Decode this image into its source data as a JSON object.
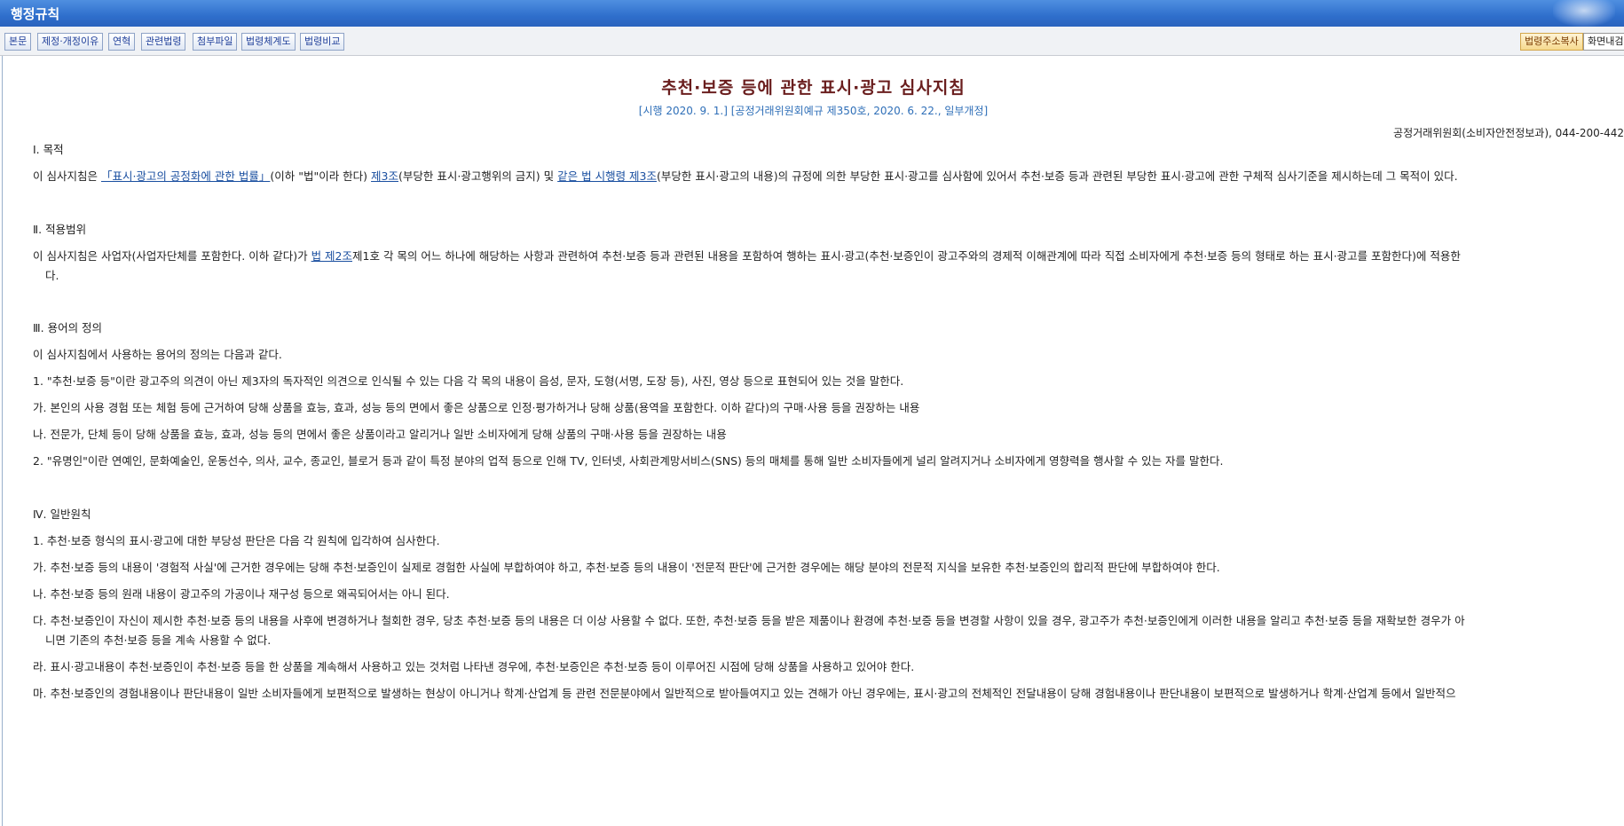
{
  "window": {
    "title": "행정규칙"
  },
  "toolbar": {
    "buttons": [
      "본문",
      "제정·개정이유",
      "연혁",
      "관련법령",
      "첨부파일",
      "법령체계도",
      "법령비교"
    ],
    "copy_address": "법령주소복사",
    "screen_content": "화면내검"
  },
  "doc": {
    "title": "추천·보증 등에 관한 표시·광고 심사지침",
    "subtitle": "[시행 2020. 9. 1.] [공정거래위원회예규 제350호, 2020. 6. 22., 일부개정]",
    "department": "공정거래위원회(소비자안전정보과), 044-200-442",
    "s1": {
      "heading": "Ⅰ. 목적",
      "p_a": "이 심사지침은 ",
      "link_law": "「표시·광고의 공정화에 관한 법률」",
      "p_b": "(이하 \"법\"이라 한다) ",
      "link_art3": "제3조",
      "p_c": "(부당한 표시·광고행위의 금지) 및 ",
      "link_decree": "같은 법 시행령 제3조",
      "p_d": "(부당한 표시·광고의 내용)의 규정에 의한 부당한 표시·광고를 심사함에 있어서 추천·보증 등과 관련된 부당한 표시·광고에 관한 구체적 심사기준을 제시하는데 그 목적이 있다."
    },
    "s2": {
      "heading": "Ⅱ. 적용범위",
      "p_a": "이 심사지침은 사업자(사업자단체를 포함한다. 이하 같다)가 ",
      "link_art2": "법 제2조",
      "p_b": "제1호 각 목의 어느 하나에 해당하는 사항과 관련하여 추천·보증 등과 관련된 내용을 포함하여 행하는 표시·광고(추천·보증인이 광고주와의 경제적 이해관계에 따라 직접 소비자에게 추천·보증 등의 형태로 하는 표시·광고를 포함한다)에 적용한",
      "p_c": "다."
    },
    "s3": {
      "heading": "Ⅲ. 용어의 정의",
      "intro": "이 심사지침에서 사용하는 용어의 정의는 다음과 같다.",
      "item1": "1. \"추천·보증 등\"이란 광고주의 의견이 아닌 제3자의 독자적인 의견으로 인식될 수 있는 다음 각 목의 내용이 음성, 문자, 도형(서명, 도장 등), 사진, 영상 등으로 표현되어 있는 것을 말한다.",
      "item1_ga": "가. 본인의 사용 경험 또는 체험 등에 근거하여 당해 상품을 효능, 효과, 성능 등의 면에서 좋은 상품으로 인정·평가하거나 당해 상품(용역을 포함한다. 이하 같다)의 구매·사용 등을 권장하는 내용",
      "item1_na": "나. 전문가, 단체 등이 당해 상품을 효능, 효과, 성능 등의 면에서 좋은 상품이라고 알리거나 일반 소비자에게 당해 상품의 구매·사용 등을 권장하는 내용",
      "item2": "2. \"유명인\"이란 연예인, 문화예술인, 운동선수, 의사, 교수, 종교인, 블로거 등과 같이 특정 분야의 업적 등으로 인해 TV, 인터넷, 사회관계망서비스(SNS) 등의 매체를 통해 일반 소비자들에게 널리 알려지거나 소비자에게 영향력을 행사할 수 있는 자를 말한다."
    },
    "s4": {
      "heading": "Ⅳ. 일반원칙",
      "item1": "1. 추천·보증 형식의 표시·광고에 대한 부당성 판단은 다음 각 원칙에 입각하여 심사한다.",
      "ga": "가. 추천·보증 등의 내용이 '경험적 사실'에 근거한 경우에는 당해 추천·보증인이 실제로 경험한 사실에 부합하여야 하고, 추천·보증 등의 내용이 '전문적 판단'에 근거한 경우에는 해당 분야의 전문적 지식을 보유한 추천·보증인의 합리적 판단에 부합하여야 한다.",
      "na": "나. 추천·보증 등의 원래 내용이 광고주의 가공이나 재구성 등으로 왜곡되어서는 아니 된다.",
      "da": "다. 추천·보증인이 자신이 제시한 추천·보증 등의 내용을 사후에 변경하거나 철회한 경우, 당초 추천·보증 등의 내용은 더 이상 사용할 수 없다. 또한, 추천·보증 등을 받은 제품이나 환경에 추천·보증 등을 변경할 사항이 있을 경우, 광고주가 추천·보증인에게 이러한 내용을 알리고 추천·보증 등을 재확보한 경우가 아",
      "da_cont": "니면 기존의 추천·보증 등을 계속 사용할 수 없다.",
      "ra": "라. 표시·광고내용이 추천·보증인이 추천·보증 등을 한 상품을 계속해서 사용하고 있는 것처럼 나타낸 경우에, 추천·보증인은 추천·보증 등이 이루어진 시점에 당해 상품을 사용하고 있어야 한다.",
      "ma": "마. 추천·보증인의 경험내용이나 판단내용이 일반 소비자들에게 보편적으로 발생하는 현상이 아니거나 학계·산업계 등 관련 전문분야에서 일반적으로 받아들여지고 있는 견해가 아닌 경우에는, 표시·광고의 전체적인 전달내용이 당해 경험내용이나 판단내용이 보편적으로 발생하거나 학계·산업계 등에서 일반적으"
    }
  }
}
